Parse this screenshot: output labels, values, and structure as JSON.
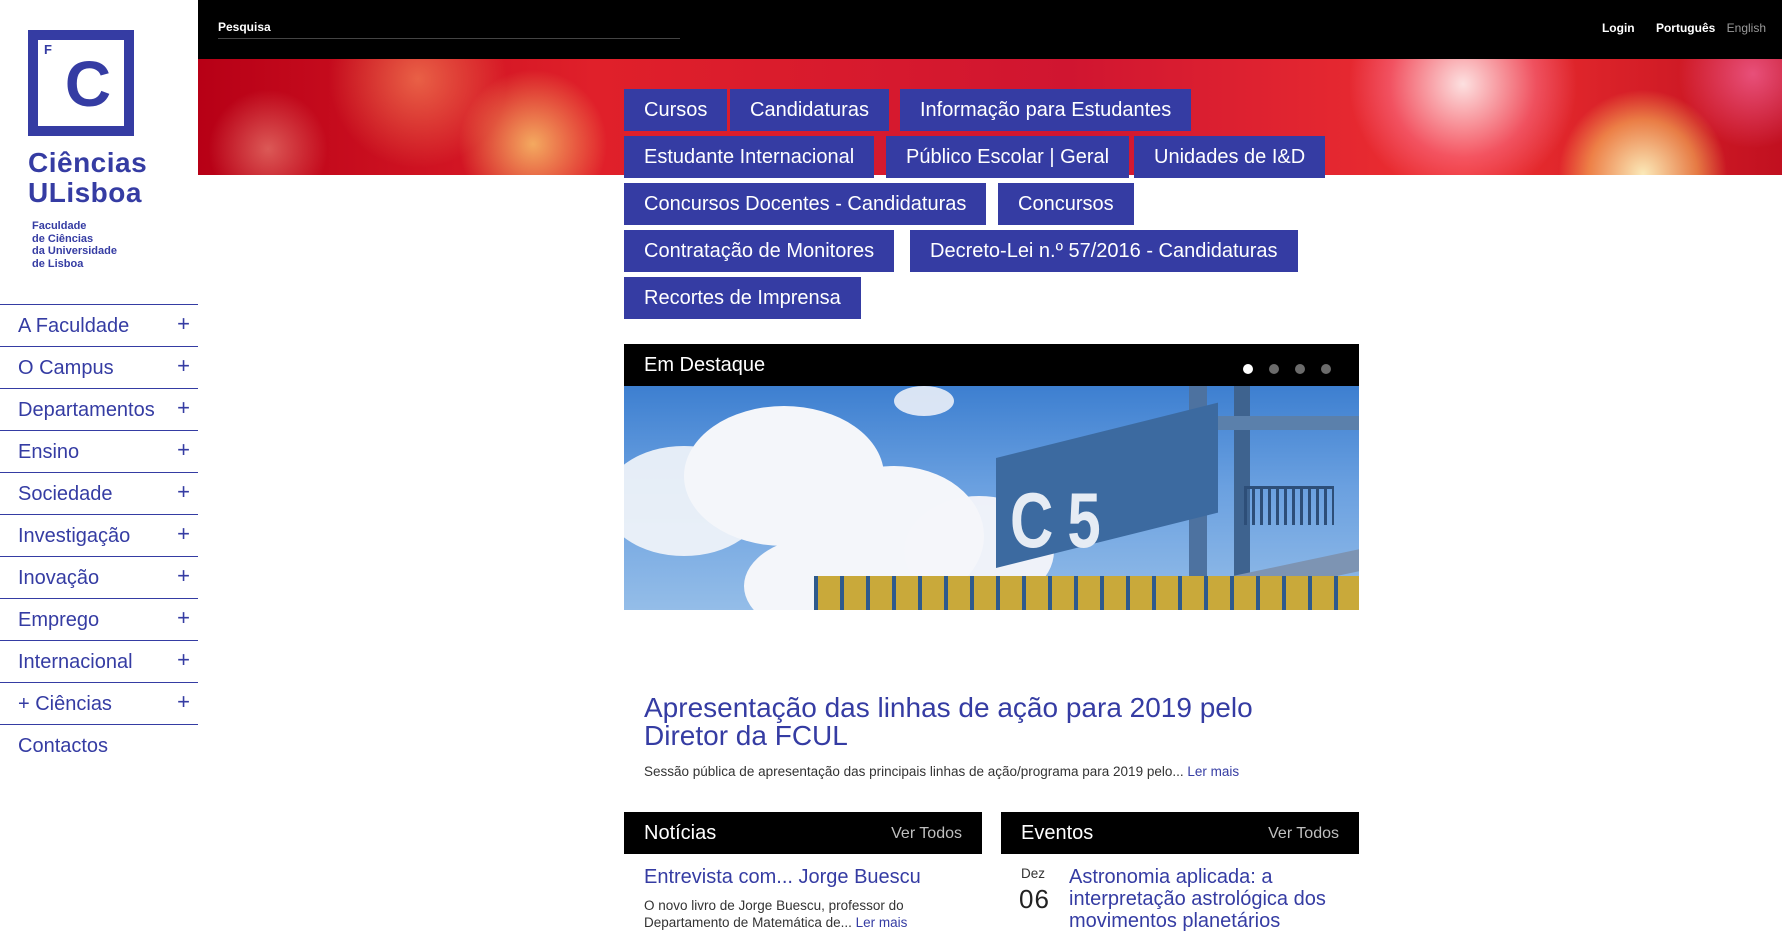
{
  "brand": {
    "logo_letter_small": "F",
    "logo_letter_big": "C",
    "name_line1": "Ciências",
    "name_line2": "ULisboa",
    "sub_line1": "Faculdade",
    "sub_line2": "de Ciências",
    "sub_line3": "da Universidade",
    "sub_line4": "de Lisboa",
    "color": "#353ca3"
  },
  "topbar": {
    "search_placeholder": "Pesquisa",
    "login": "Login",
    "lang_current": "Português",
    "lang_other": "English"
  },
  "sidebar": {
    "items": [
      {
        "label": "A Faculdade",
        "expand": "+"
      },
      {
        "label": "O Campus",
        "expand": "+"
      },
      {
        "label": "Departamentos",
        "expand": "+"
      },
      {
        "label": "Ensino",
        "expand": "+"
      },
      {
        "label": "Sociedade",
        "expand": "+"
      },
      {
        "label": "Investigação",
        "expand": "+"
      },
      {
        "label": "Inovação",
        "expand": "+"
      },
      {
        "label": "Emprego",
        "expand": "+"
      },
      {
        "label": "Internacional",
        "expand": "+"
      },
      {
        "label": "+ Ciências",
        "expand": "+"
      }
    ],
    "contacts": "Contactos"
  },
  "quick_links": [
    "Cursos",
    "Candidaturas",
    "Informação para Estudantes",
    "Estudante Internacional",
    "Público Escolar | Geral",
    "Unidades de I&D",
    "Concursos Docentes - Candidaturas",
    "Concursos",
    "Contratação de Monitores",
    "Decreto-Lei n.º 57/2016 - Candidaturas",
    "Recortes de Imprensa"
  ],
  "featured": {
    "heading": "Em Destaque",
    "slides_total": 4,
    "slide_active": 1,
    "building_label": "C5",
    "story_title": "Apresentação das linhas de ação para 2019 pelo Diretor da FCUL",
    "story_text": "Sessão pública de apresentação das principais linhas de ação/programa para 2019 pelo...",
    "story_more": "Ler mais"
  },
  "news": {
    "heading": "Notícias",
    "see_all": "Ver Todos",
    "item_title": "Entrevista com... Jorge Buescu",
    "item_text": "O novo livro de Jorge Buescu, professor do Departamento de Matemática de...",
    "item_more": "Ler mais"
  },
  "events": {
    "heading": "Eventos",
    "see_all": "Ver Todos",
    "item_month": "Dez",
    "item_day": "06",
    "item_title": "Astronomia aplicada: a interpretação astrológica dos movimentos planetários"
  }
}
